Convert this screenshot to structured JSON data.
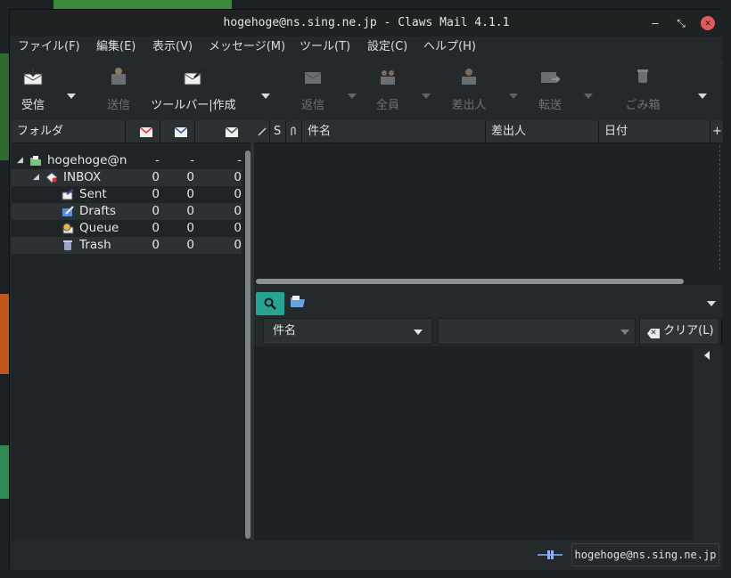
{
  "window": {
    "title": "hogehoge@ns.sing.ne.jp - Claws Mail 4.1.1",
    "minimize": "‒",
    "maximize": "⤡",
    "close": "✕"
  },
  "menu": {
    "items": [
      "ファイル(F)",
      "編集(E)",
      "表示(V)",
      "メッセージ(M)",
      "ツール(T)",
      "設定(C)",
      "ヘルプ(H)"
    ]
  },
  "toolbar": {
    "receive": "受信",
    "send": "送信",
    "compose": "ツールバー|作成",
    "reply": "返信",
    "reply_all": "全員",
    "reply_sender": "差出人",
    "forward": "転送",
    "trash": "ごみ箱"
  },
  "folder_pane": {
    "header": "フォルダ",
    "account": {
      "name": "hogehoge@ns",
      "new": "-",
      "unread": "-",
      "total": "-"
    },
    "folders": [
      {
        "name": "INBOX",
        "new": "0",
        "unread": "0",
        "total": "0"
      },
      {
        "name": "Sent",
        "new": "0",
        "unread": "0",
        "total": "0"
      },
      {
        "name": "Drafts",
        "new": "0",
        "unread": "0",
        "total": "0"
      },
      {
        "name": "Queue",
        "new": "0",
        "unread": "0",
        "total": "0"
      },
      {
        "name": "Trash",
        "new": "0",
        "unread": "0",
        "total": "0"
      }
    ]
  },
  "message_list": {
    "columns": {
      "status": "S",
      "subject": "件名",
      "from": "差出人",
      "date": "日付"
    }
  },
  "search": {
    "field": "件名",
    "value": "",
    "clear": "クリア(L)"
  },
  "statusbar": {
    "account": "hogehoge@ns.sing.ne.jp"
  },
  "colors": {
    "accent": "#27a392",
    "window_bg": "#24292b",
    "close": "#e05a5a"
  }
}
